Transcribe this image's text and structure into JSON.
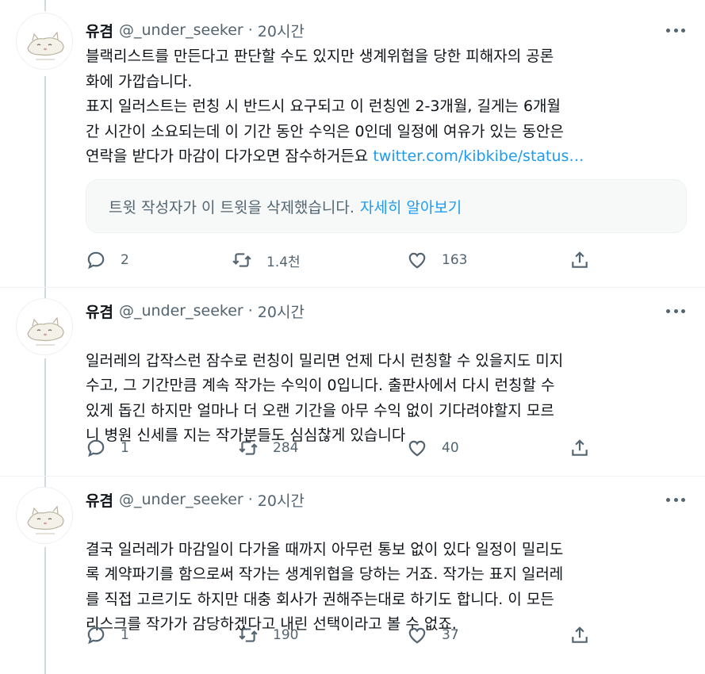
{
  "tweets": [
    {
      "name": "유겸",
      "handle": "@_under_seeker",
      "separator": "·",
      "time": "20시간",
      "body": "블랙리스트를 만든다고 판단할 수도 있지만 생계위협을 당한 피해자의 공론\n화에 가깝습니다.\n표지 일러스트는 런칭 시 반드시 요구되고 이 런칭엔 2-3개월, 길게는 6개월\n간 시간이 소요되는데 이 기간 동안 수익은 0인데 일정에 여유가 있는 동안은\n연락을 받다가 마감이 다가오면 잠수하거든요 ",
      "link": "twitter.com/kibkibe/status…",
      "deleted_notice": "트윗 작성자가 이 트윗을 삭제했습니다.",
      "learn_more": "자세히 알아보기",
      "replies": "2",
      "retweets": "1.4천",
      "likes": "163"
    },
    {
      "name": "유겸",
      "handle": "@_under_seeker",
      "separator": "·",
      "time": "20시간",
      "body": "일러레의 갑작스런 잠수로 런칭이 밀리면 언제 다시 런칭할 수 있을지도 미지\n수고, 그 기간만큼 계속 작가는 수익이 0입니다. 출판사에서 다시 런칭할 수\n있게 돕긴 하지만 얼마나 더 오랜 기간을 아무 수익 없이 기다려야할지 모르\n니 병원 신세를 지는 작가분들도 심심찮게 있습니다",
      "replies": "1",
      "retweets": "284",
      "likes": "40"
    },
    {
      "name": "유겸",
      "handle": "@_under_seeker",
      "separator": "·",
      "time": "20시간",
      "body": "결국 일러레가 마감일이 다가올 때까지 아무런 통보 없이 있다 일정이 밀리도\n록 계약파기를 함으로써 작가는 생계위협을 당하는 거죠. 작가는 표지 일러레\n를 직접 고르기도 하지만 대충 회사가 권해주는대로 하기도 합니다. 이 모든\n리스크를 작가가 감당하겠다고 내린 선택이라고 볼 수 없죠.",
      "replies": "1",
      "retweets": "190",
      "likes": "37"
    }
  ],
  "icons": {
    "avatar": "cat-avatar-icon",
    "more": "more-icon",
    "reply": "reply-icon",
    "retweet": "retweet-icon",
    "like": "heart-icon",
    "share": "share-icon"
  },
  "colors": {
    "link": "#1d9bf0",
    "secondary_text": "#536471",
    "primary_text": "#0f1419",
    "thread_line": "#cfd9de",
    "card_background": "#f7f9f9"
  }
}
